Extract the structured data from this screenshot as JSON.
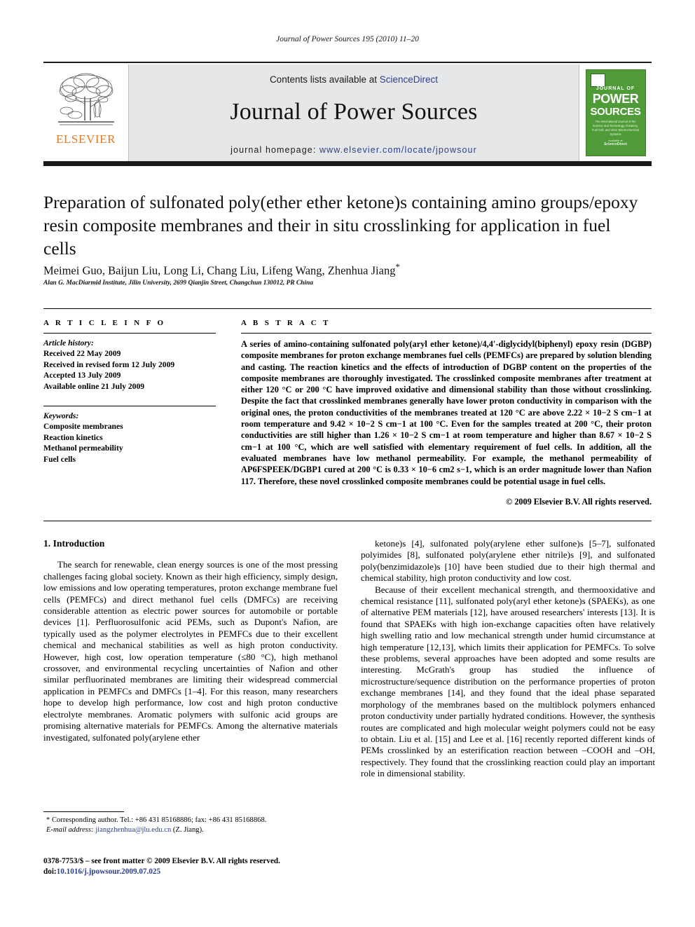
{
  "running_head": "Journal of Power Sources 195 (2010) 11–20",
  "masthead": {
    "contents_prefix": "Contents lists available at ",
    "sciencedirect": "ScienceDirect",
    "journal_title": "Journal of Power Sources",
    "homepage_label": "journal homepage:",
    "homepage_url": "www.elsevier.com/locate/jpowsour",
    "publisher_wordmark": "ELSEVIER",
    "publisher_color": "#E87722",
    "link_color": "#2b3f8c",
    "band_color": "#e6e7e9",
    "cover": {
      "line1": "JOURNAL OF",
      "line2": "POWER",
      "line3": "SOURCES",
      "subtitle": "The International Journal of the Science and Technology of Battery, Fuel Cell, and other Electrochemical Systems",
      "sciencedirect_note": "available at",
      "sciencedirect_label": "ScienceDirect",
      "cover_color": "#4e9b37",
      "accent_color": "#e8552a"
    }
  },
  "article": {
    "title": "Preparation of sulfonated poly(ether ether ketone)s containing amino groups/epoxy resin composite membranes and their in situ crosslinking for application in fuel cells",
    "authors": "Meimei Guo, Baijun Liu, Long Li, Chang Liu, Lifeng Wang, Zhenhua Jiang",
    "corresponding_marker": "*",
    "affiliation": "Alan G. MacDiarmid Institute, Jilin University, 2699 Qianjin Street, Changchun 130012, PR China"
  },
  "info": {
    "heading": "A R T I C L E   I N F O",
    "history_label": "Article history:",
    "history": [
      "Received 22 May 2009",
      "Received in revised form 12 July 2009",
      "Accepted 13 July 2009",
      "Available online 21 July 2009"
    ],
    "keywords_label": "Keywords:",
    "keywords": [
      "Composite membranes",
      "Reaction kinetics",
      "Methanol permeability",
      "Fuel cells"
    ]
  },
  "abstract": {
    "heading": "A B S T R A C T",
    "text": "A series of amino-containing sulfonated poly(aryl ether ketone)/4,4′-diglycidyl(biphenyl) epoxy resin (DGBP) composite membranes for proton exchange membranes fuel cells (PEMFCs) are prepared by solution blending and casting. The reaction kinetics and the effects of introduction of DGBP content on the properties of the composite membranes are thoroughly investigated. The crosslinked composite membranes after treatment at either 120 °C or 200 °C have improved oxidative and dimensional stability than those without crosslinking. Despite the fact that crosslinked membranes generally have lower proton conductivity in comparison with the original ones, the proton conductivities of the membranes treated at 120 °C are above 2.22 × 10−2 S cm−1 at room temperature and 9.42 × 10−2 S cm−1 at 100 °C. Even for the samples treated at 200 °C, their proton conductivities are still higher than 1.26 × 10−2 S cm−1 at room temperature and higher than 8.67 × 10−2 S cm−1 at 100 °C, which are well satisfied with elementary requirement of fuel cells. In addition, all the evaluated membranes have low methanol permeability. For example, the methanol permeability of AP6FSPEEK/DGBP1 cured at 200 °C is 0.33 × 10−6 cm2 s−1, which is an order magnitude lower than Nafion 117. Therefore, these novel crosslinked composite membranes could be potential usage in fuel cells.",
    "copyright": "© 2009 Elsevier B.V. All rights reserved."
  },
  "body": {
    "section_number_title": "1.  Introduction",
    "left_paragraph_1": "The search for renewable, clean energy sources is one of the most pressing challenges facing global society. Known as their high efficiency, simply design, low emissions and low operating temperatures, proton exchange membrane fuel cells (PEMFCs) and direct methanol fuel cells (DMFCs) are receiving considerable attention as electric power sources for automobile or portable devices [1]. Perfluorosulfonic acid PEMs, such as Dupont's Nafion, are typically used as the polymer electrolytes in PEMFCs due to their excellent chemical and mechanical stabilities as well as high proton conductivity. However, high cost, low operation temperature (≤80 °C), high methanol crossover, and environmental recycling uncertainties of Nafion and other similar perfluorinated membranes are limiting their widespread commercial application in PEMFCs and DMFCs [1–4]. For this reason, many researchers hope to develop high performance, low cost and high proton conductive electrolyte membranes. Aromatic polymers with sulfonic acid groups are promising alternative materials for PEMFCs. Among the alternative materials investigated, sulfonated poly(arylene ether",
    "right_paragraph_1": "ketone)s [4], sulfonated poly(arylene ether sulfone)s [5–7], sulfonated polyimides [8], sulfonated poly(arylene ether nitrile)s [9], and sulfonated poly(benzimidazole)s [10] have been studied due to their high thermal and chemical stability, high proton conductivity and low cost.",
    "right_paragraph_2": "Because of their excellent mechanical strength, and thermooxidative and chemical resistance [11], sulfonated poly(aryl ether ketone)s (SPAEKs), as one of alternative PEM materials [12], have aroused researchers' interests [13]. It is found that SPAEKs with high ion-exchange capacities often have relatively high swelling ratio and low mechanical strength under humid circumstance at high temperature [12,13], which limits their application for PEMFCs. To solve these problems, several approaches have been adopted and some results are interesting. McGrath's group has studied the influence of microstructure/sequence distribution on the performance properties of proton exchange membranes [14], and they found that the ideal phase separated morphology of the membranes based on the multiblock polymers enhanced proton conductivity under partially hydrated conditions. However, the synthesis routes are complicated and high molecular weight polymers could not be easy to obtain. Liu et al. [15] and Lee et al. [16] recently reported different kinds of PEMs crosslinked by an esterification reaction between –COOH and –OH, respectively. They found that the crosslinking reaction could play an important role in dimensional stability."
  },
  "footnote": {
    "marker": "*",
    "corresponding": "Corresponding author. Tel.: +86 431 85168886; fax: +86 431 85168868.",
    "email_label": "E-mail address:",
    "email": "jiangzhenhua@jlu.edu.cn",
    "email_suffix": "(Z. Jiang)."
  },
  "imprint": {
    "line1": "0378-7753/$ – see front matter © 2009 Elsevier B.V. All rights reserved.",
    "doi_label": "doi:",
    "doi": "10.1016/j.jpowsour.2009.07.025"
  }
}
